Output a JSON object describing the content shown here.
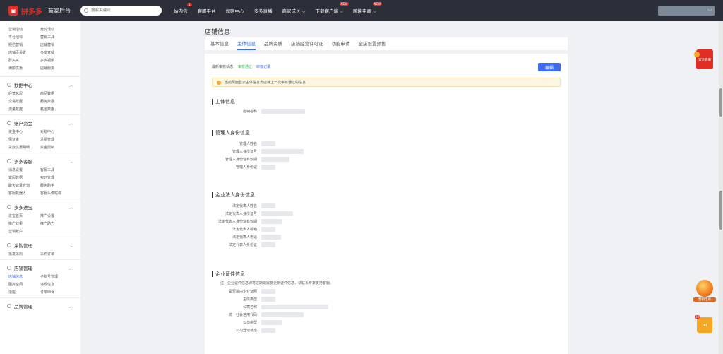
{
  "topbar": {
    "logo_text": "拼多多",
    "logo_sub": "商家后台",
    "search_placeholder": "搜索关键词",
    "nav": [
      {
        "label": "站内信",
        "badge": "1"
      },
      {
        "label": "客服平台"
      },
      {
        "label": "规则中心"
      },
      {
        "label": "多多直播"
      },
      {
        "label": "商家成长 ⌵"
      },
      {
        "label": "下载客户端 ⌵",
        "new": "NEW"
      },
      {
        "label": "跨境电商 ⌵",
        "new": "NEW"
      }
    ]
  },
  "sidebar": {
    "top_links": [
      "营销活动",
      "竞价活动",
      "平台招标",
      "营销工具",
      "短信营销",
      "店铺营销",
      "店铺页设置",
      "多多直播",
      "群买买",
      "多多视频",
      "满额优惠",
      "店铺服务"
    ],
    "groups": [
      {
        "title": "数据中心",
        "links": [
          "经营总况",
          "商品数据",
          "交易数据",
          "服务数据",
          "流量数据",
          "粘运数据"
        ]
      },
      {
        "title": "账户资金",
        "links": [
          "资金中心",
          "对账中心",
          "保证金",
          "发票管理",
          "货款优惠明细",
          "资金限制"
        ]
      },
      {
        "title": "多多客服",
        "links": [
          "消息设置",
          "客服工具",
          "客服数据",
          "实时管理",
          "聊天记录查询",
          "服务助手",
          "客服机器人",
          "客服头像昵称"
        ]
      },
      {
        "title": "多多进宝",
        "links": [
          "进宝首页",
          "推广设置",
          "推广效果",
          "推广助力",
          "营销账户"
        ]
      },
      {
        "title": "采购管理",
        "links": [
          "批发采购",
          "采购订单"
        ]
      },
      {
        "title": "店铺管理",
        "links": [
          "店铺信息",
          "子账号管理",
          "图片空间",
          "违规信息",
          "退店",
          "订单申诉"
        ]
      },
      {
        "title": "品牌管理",
        "links": []
      }
    ]
  },
  "main": {
    "page_title": "店铺信息",
    "tabs": [
      "基本信息",
      "主体信息",
      "品牌资质",
      "店铺经营许可证",
      "功能申请",
      "全店设置预售"
    ],
    "status_label": "最新审核状态：",
    "status_value": "审核通过",
    "record_link": "审核记录",
    "edit_button": "编辑",
    "notice": "当前页面显示主体信息为店铺上一次审核通过的信息",
    "sections": [
      {
        "title": "主体信息",
        "fields": [
          "店铺名称"
        ]
      },
      {
        "title": "管理人身份信息",
        "fields": [
          "管理人姓名",
          "管理人身份证号",
          "管理人身份证有效期",
          "管理人身份证"
        ]
      },
      {
        "title": "企业法人身份信息",
        "fields": [
          "法定代表人姓名",
          "法定代表人身份证号",
          "法定代表人身份证有效期",
          "法定代表人邮箱",
          "法定代表人电话",
          "法定代表人身份证"
        ]
      },
      {
        "title": "企业证件信息",
        "note": "注：企业证件信息即将过期或需要更新证件信息，请联系专家支持客服。",
        "fields": [
          "是否境内企业证照",
          "主体类型",
          "公司名称",
          "统一社会信用代码",
          "公司类型",
          "公司登记状态"
        ]
      }
    ]
  },
  "floats": {
    "kefu": "官方客服",
    "yingxiao": "营销电商",
    "mail_badge": "10"
  }
}
